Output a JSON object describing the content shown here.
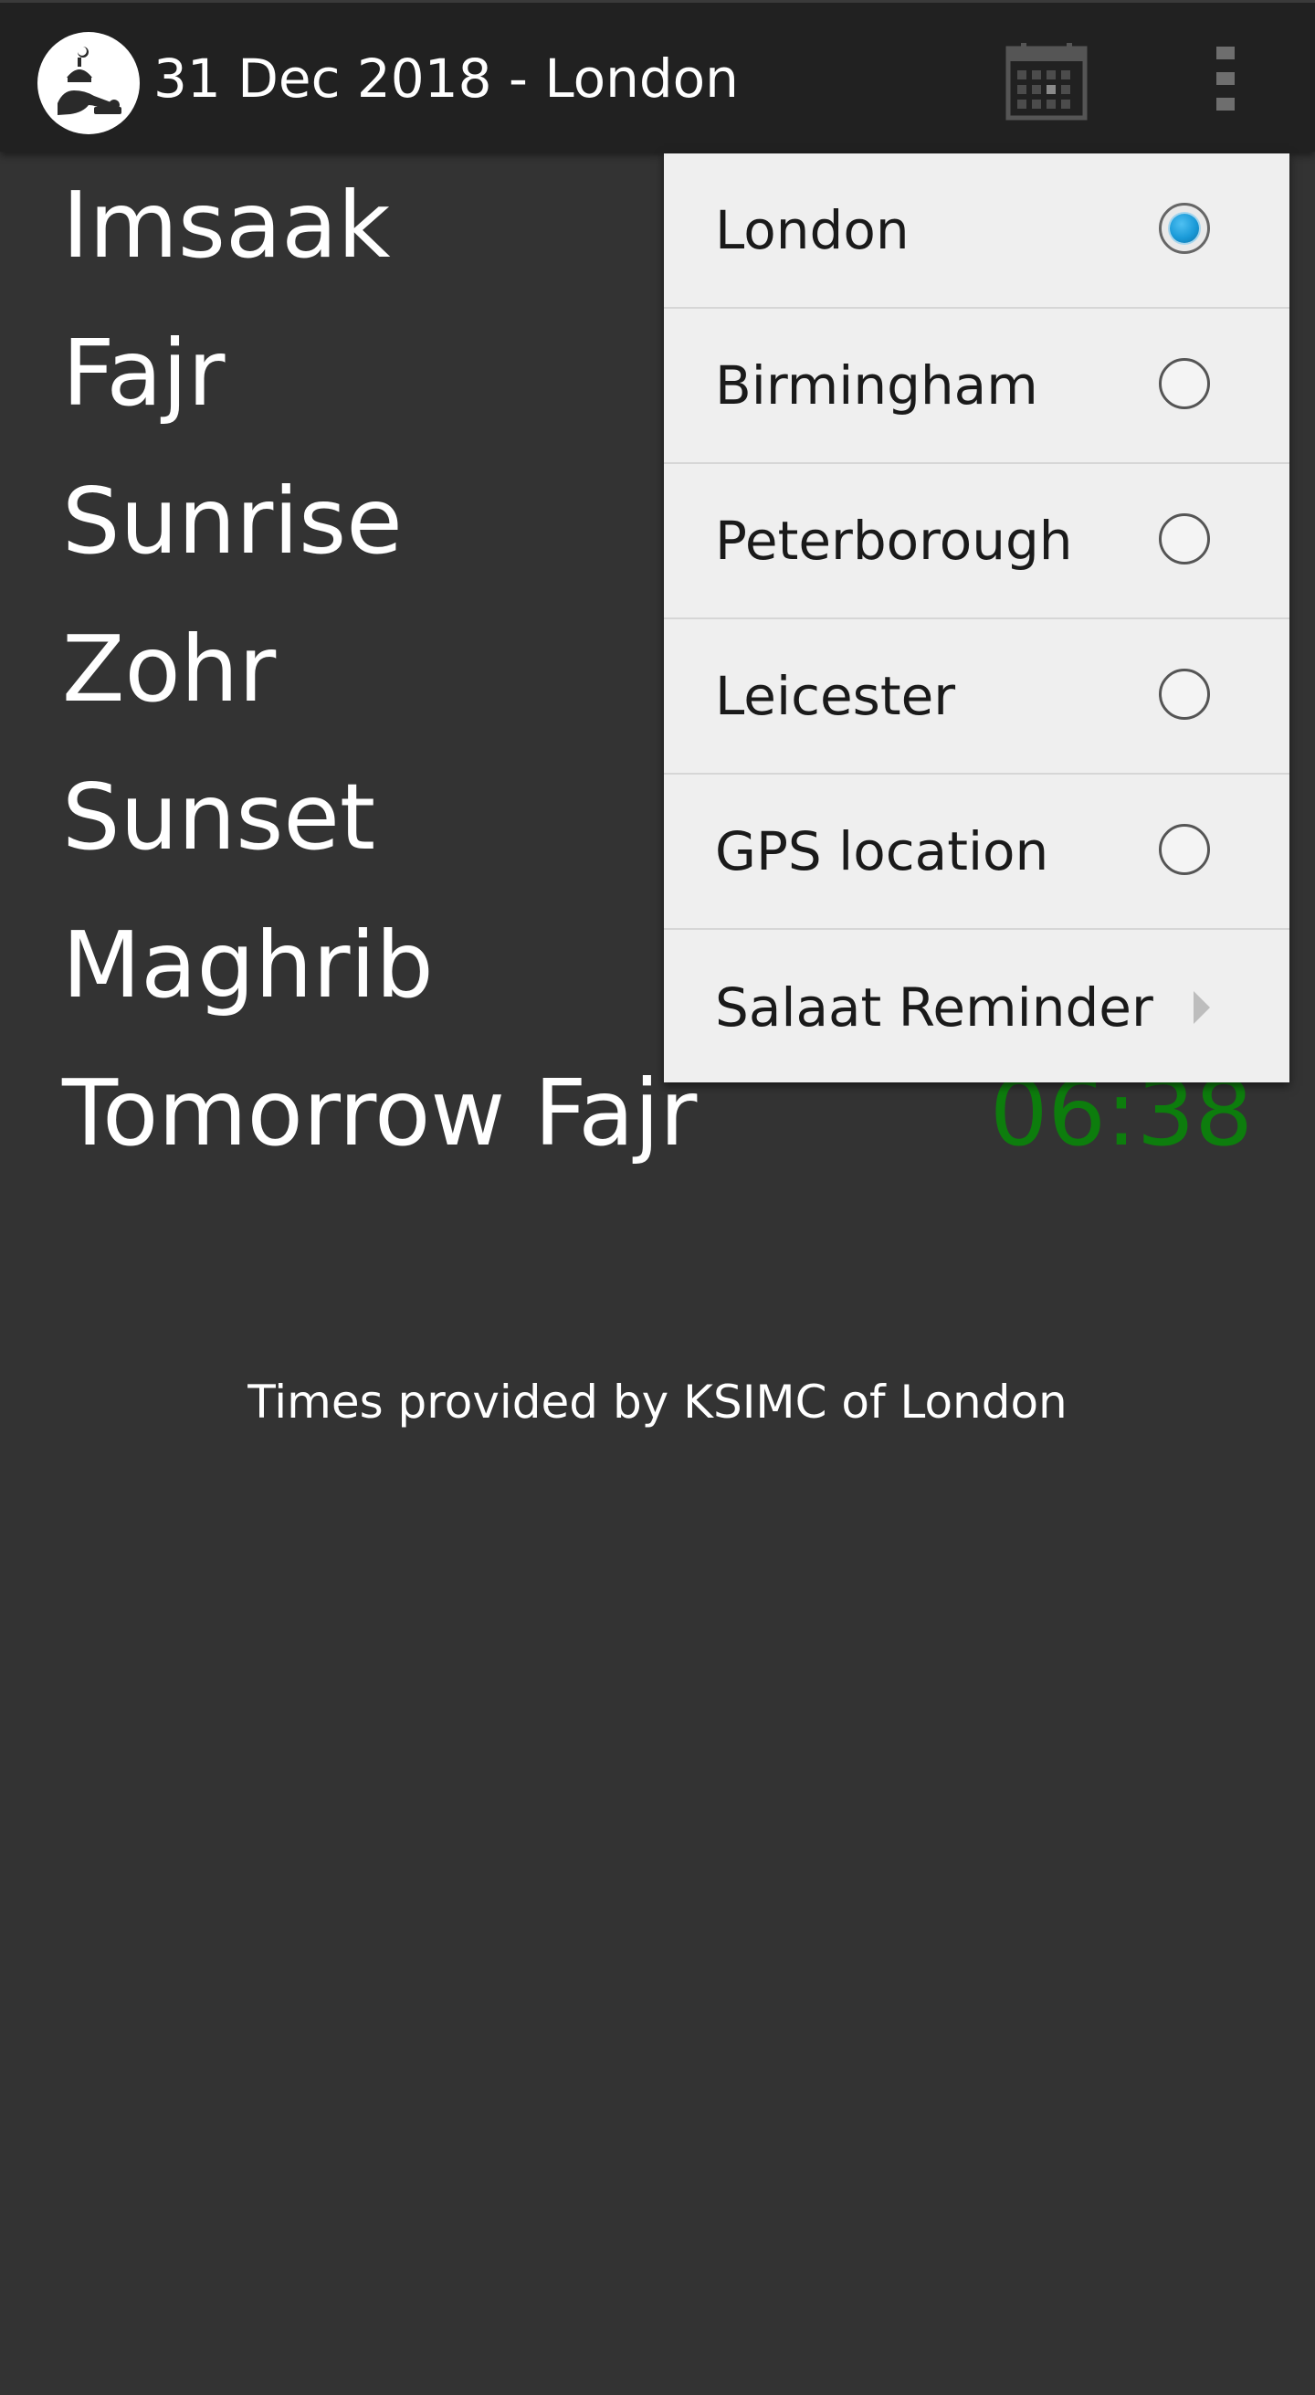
{
  "app_bar": {
    "title": "31 Dec 2018 - London",
    "logo_icon": "prostrating-worshipper-icon",
    "calendar_icon": "calendar-icon",
    "overflow_icon": "more-vertical-icon"
  },
  "times": [
    {
      "name": "Imsaak",
      "time": ""
    },
    {
      "name": "Fajr",
      "time": ""
    },
    {
      "name": "Sunrise",
      "time": ""
    },
    {
      "name": "Zohr",
      "time": ""
    },
    {
      "name": "Sunset",
      "time": ""
    },
    {
      "name": "Maghrib",
      "time": ""
    },
    {
      "name": "Tomorrow Fajr",
      "time": "06:38"
    }
  ],
  "footer": {
    "note": "Times provided by KSIMC of London"
  },
  "menu": {
    "items": [
      {
        "label": "London",
        "type": "radio",
        "checked": true
      },
      {
        "label": "Birmingham",
        "type": "radio",
        "checked": false
      },
      {
        "label": "Peterborough",
        "type": "radio",
        "checked": false
      },
      {
        "label": "Leicester",
        "type": "radio",
        "checked": false
      },
      {
        "label": "GPS location",
        "type": "radio",
        "checked": false
      },
      {
        "label": "Salaat Reminder",
        "type": "submenu"
      }
    ]
  },
  "colors": {
    "background": "#333333",
    "app_bar": "#212121",
    "time_text": "#0d7d0d",
    "menu_background": "#efefef",
    "radio_selected": "#1a9ad8"
  }
}
